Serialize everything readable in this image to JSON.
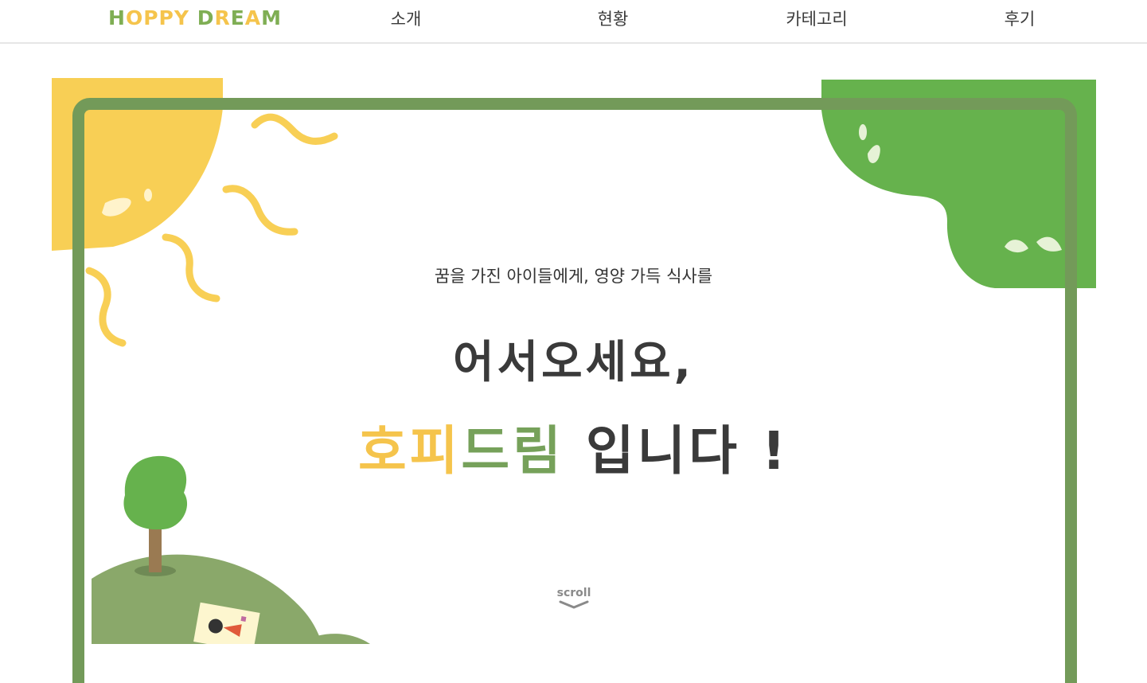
{
  "nav": {
    "logo": [
      "H",
      "O",
      "P",
      "P",
      "Y",
      " ",
      "D",
      "R",
      "E",
      "A",
      "M"
    ],
    "logo_colors": [
      "#7fae54",
      "#f5c44c",
      "#f5c44c",
      "#f5c44c",
      "#f5c44c",
      "#ffffff",
      "#7fae54",
      "#f5c44c",
      "#7fae54",
      "#f5c44c",
      "#7fae54"
    ],
    "items": [
      "소개",
      "현황",
      "카테고리",
      "후기"
    ]
  },
  "hero": {
    "subtitle": "꿈을 가진 아이들에게, 영양 가득 식사를",
    "line1": "어서오세요,",
    "brand_part1": "호피",
    "brand_part2": "드림",
    "line2_rest": " 입니다 !",
    "scroll_label": "scroll"
  },
  "colors": {
    "frame": "#739a59",
    "sun": "#f8cf55",
    "leaf": "#66b24d",
    "hill": "#8aa86a"
  }
}
